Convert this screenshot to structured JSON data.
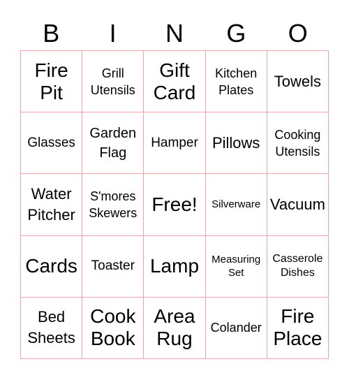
{
  "header": {
    "letters": [
      "B",
      "I",
      "N",
      "G",
      "O"
    ]
  },
  "card": {
    "border_color": "#f2a3aa",
    "rows": [
      [
        "Fire Pit",
        "Grill Utensils",
        "Gift Card",
        "Kitchen Plates",
        "Towels"
      ],
      [
        "Glasses",
        "Garden Flag",
        "Hamper",
        "Pillows",
        "Cooking Utensils"
      ],
      [
        "Water Pitcher",
        "S'mores Skewers",
        "Free!",
        "Silverware",
        "Vacuum"
      ],
      [
        "Cards",
        "Toaster",
        "Lamp",
        "Measuring Set",
        "Casserole Dishes"
      ],
      [
        "Bed Sheets",
        "Cook Book",
        "Area Rug",
        "Colander",
        "Fire Place"
      ]
    ]
  }
}
